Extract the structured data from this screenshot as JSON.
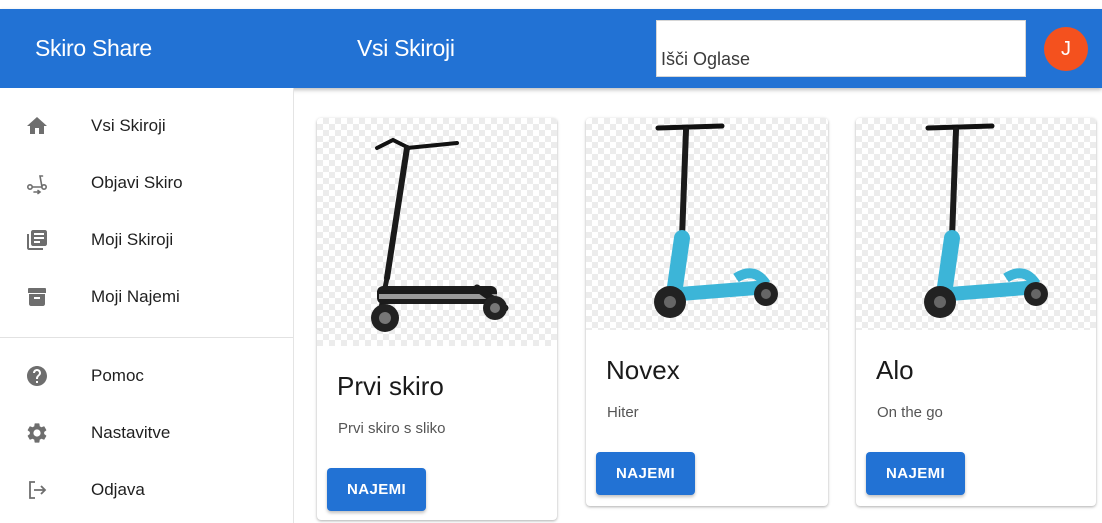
{
  "app": {
    "title": "Skiro Share",
    "page_title": "Vsi Skiroji"
  },
  "search": {
    "placeholder": "Išči Oglase",
    "value": ""
  },
  "user": {
    "avatar_initial": "J",
    "avatar_color": "#f4511e"
  },
  "colors": {
    "primary": "#2272d4",
    "accent": "#f4511e"
  },
  "sidebar": {
    "items": [
      {
        "label": "Vsi Skiroji",
        "icon": "home-icon"
      },
      {
        "label": "Objavi Skiro",
        "icon": "scooter-icon"
      },
      {
        "label": "Moji Skiroji",
        "icon": "library-books-icon"
      },
      {
        "label": "Moji Najemi",
        "icon": "archive-icon"
      }
    ],
    "secondary_items": [
      {
        "label": "Pomoc",
        "icon": "help-icon"
      },
      {
        "label": "Nastavitve",
        "icon": "gear-icon"
      },
      {
        "label": "Odjava",
        "icon": "logout-icon"
      }
    ]
  },
  "cards": [
    {
      "title": "Prvi skiro",
      "description": "Prvi skiro s sliko",
      "button": "NAJEMI",
      "image": "black-scooter-image"
    },
    {
      "title": "Novex",
      "description": "Hiter",
      "button": "NAJEMI",
      "image": "blue-scooter-image"
    },
    {
      "title": "Alo",
      "description": "On the go",
      "button": "NAJEMI",
      "image": "blue-scooter-image"
    }
  ]
}
